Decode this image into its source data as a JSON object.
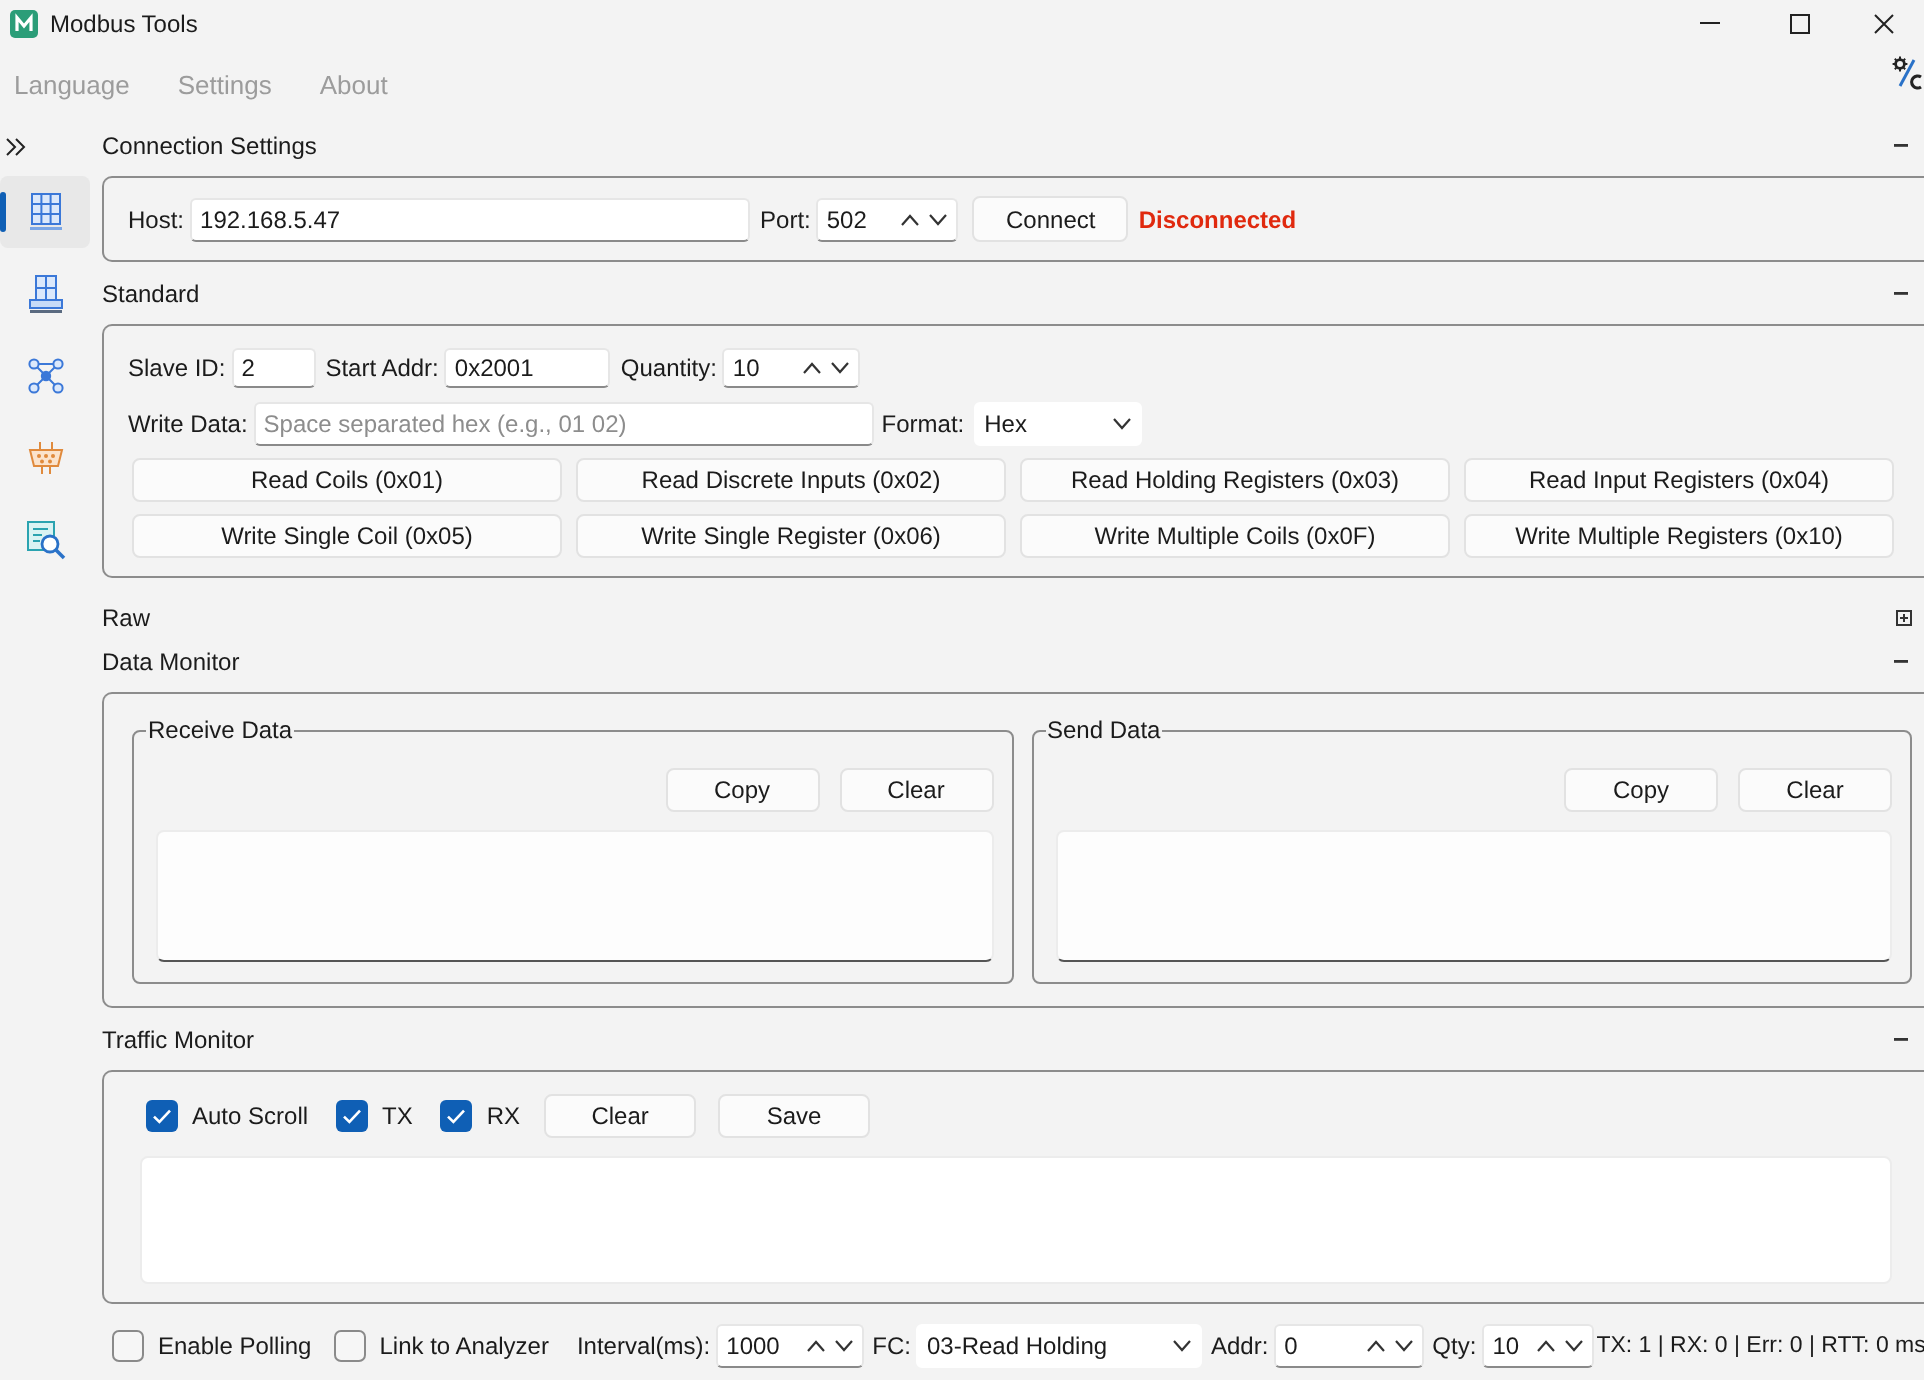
{
  "window": {
    "title": "Modbus Tools"
  },
  "menu": [
    {
      "label": "Language",
      "disabled": true
    },
    {
      "label": "Settings",
      "disabled": true
    },
    {
      "label": "About",
      "disabled": true
    }
  ],
  "sidebar": {
    "items": [
      {
        "kind": "grid",
        "selected": true
      },
      {
        "kind": "server",
        "selected": false
      },
      {
        "kind": "network",
        "selected": false
      },
      {
        "kind": "serial",
        "selected": false
      },
      {
        "kind": "analyzer",
        "selected": false
      }
    ]
  },
  "connection_settings": {
    "title": "Connection Settings",
    "expanded": true,
    "host": {
      "label": "Host:",
      "value": "192.168.5.47"
    },
    "port": {
      "label": "Port:",
      "value": "502"
    },
    "connect_button": "Connect",
    "status": "Disconnected",
    "connected": false
  },
  "standard": {
    "title": "Standard",
    "expanded": true,
    "slave_id": {
      "label": "Slave ID:",
      "value": "2"
    },
    "start_addr": {
      "label": "Start Addr:",
      "value": "0x2001"
    },
    "quantity": {
      "label": "Quantity:",
      "value": "10"
    },
    "write_data": {
      "label": "Write Data:",
      "placeholder": "Space separated hex (e.g., 01 02)"
    },
    "format": {
      "label": "Format:",
      "value": "Hex"
    },
    "buttons": [
      "Read Coils (0x01)",
      "Read Discrete Inputs (0x02)",
      "Read Holding Registers (0x03)",
      "Read Input Registers (0x04)",
      "Write Single Coil (0x05)",
      "Write Single Register (0x06)",
      "Write Multiple Coils (0x0F)",
      "Write Multiple Registers (0x10)"
    ]
  },
  "raw": {
    "title": "Raw",
    "expanded": false
  },
  "data_monitor": {
    "title": "Data Monitor",
    "expanded": true,
    "panels": [
      {
        "title": "Receive Data",
        "buttons": [
          "Copy",
          "Clear"
        ]
      },
      {
        "title": "Send Data",
        "buttons": [
          "Copy",
          "Clear"
        ]
      }
    ]
  },
  "traffic_monitor": {
    "title": "Traffic Monitor",
    "expanded": true,
    "options": [
      {
        "label": "Auto Scroll",
        "checked": true
      },
      {
        "label": "TX",
        "checked": true
      },
      {
        "label": "RX",
        "checked": true
      }
    ],
    "buttons": [
      "Clear",
      "Save"
    ]
  },
  "polling_bar": {
    "controls": [
      {
        "kind": "checkbox",
        "label": "Enable Polling",
        "checked": false
      },
      {
        "kind": "checkbox",
        "label": "Link to Analyzer",
        "checked": false
      },
      {
        "kind": "spin",
        "label": "Interval(ms):",
        "value": "1000"
      },
      {
        "kind": "combo",
        "label": "FC:",
        "value": "03-Read Holding"
      },
      {
        "kind": "spin",
        "label": "Addr:",
        "value": "0"
      },
      {
        "kind": "spin",
        "label": "Qty:",
        "value": "10"
      }
    ],
    "stats": "TX: 1 | RX: 0 | Err: 0 | RTT: 0 ms"
  }
}
